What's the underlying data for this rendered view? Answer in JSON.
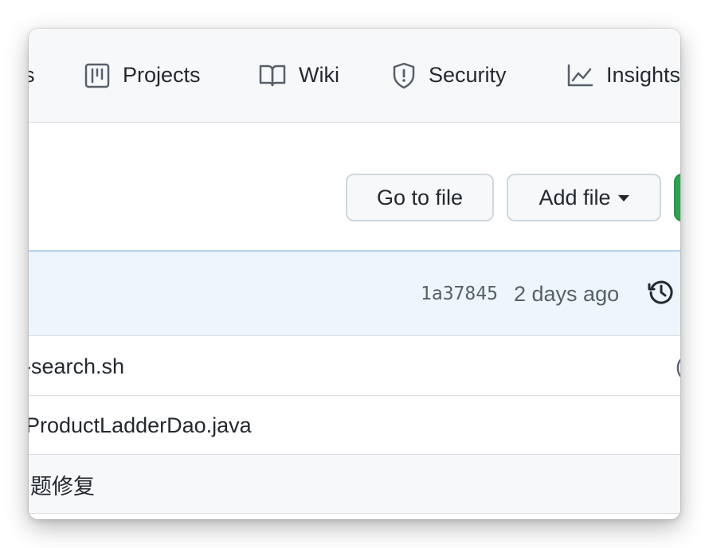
{
  "nav": {
    "items": [
      {
        "label": "s",
        "icon": "unknown-icon"
      },
      {
        "label": "Projects",
        "icon": "project-board-icon"
      },
      {
        "label": "Wiki",
        "icon": "book-icon"
      },
      {
        "label": "Security",
        "icon": "shield-icon"
      },
      {
        "label": "Insights",
        "icon": "graph-icon"
      }
    ]
  },
  "actions": {
    "go_to_file": "Go to file",
    "add_file": "Add file"
  },
  "commit": {
    "sha": "1a37845",
    "time_ago": "2 days ago",
    "icon": "history-icon"
  },
  "files": [
    {
      "name": "-search.sh",
      "trail": "("
    },
    {
      "name": "ProductLadderDao.java",
      "trail": ""
    },
    {
      "name": "题修复",
      "trail": ""
    }
  ],
  "colors": {
    "nav_bg": "#f6f8fa",
    "commit_bg": "#eef5fd",
    "primary_green": "#2da44e",
    "text": "#24292f",
    "muted": "#57606a"
  }
}
